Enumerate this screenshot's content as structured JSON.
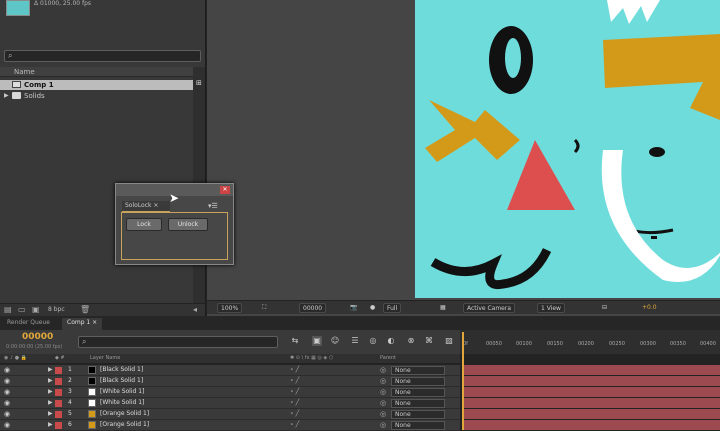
{
  "project": {
    "thumb_info": "Δ 01000, 25.00 fps",
    "search_placeholder": "",
    "column_name": "Name",
    "items": [
      {
        "label": "Comp 1"
      },
      {
        "label": "Solids"
      }
    ],
    "bpc": "8 bpc"
  },
  "viewer": {
    "zoom": "100%",
    "timecode": "00000",
    "resolution": "Full",
    "camera": "Active Camera",
    "view": "1 View",
    "exposure": "+0.0"
  },
  "solo_panel": {
    "tab_label": "SoloLock",
    "lock_label": "Lock",
    "unlock_label": "Unlock"
  },
  "tabs": {
    "render_queue": "Render Queue",
    "comp": "Comp 1"
  },
  "timeline": {
    "timecode": "00000",
    "timecode_sub": "0:00:00:00 (25.00 fps)",
    "col_layer_name": "Layer Name",
    "col_parent": "Parent",
    "ruler_ticks": [
      "0f",
      "00050",
      "00100",
      "00150",
      "00200",
      "00250",
      "00300",
      "00350",
      "00400"
    ],
    "layers": [
      {
        "num": "1",
        "name": "[Black Solid 1]",
        "parent": "None",
        "swatch": "#000000",
        "label_color": "#c84a4a"
      },
      {
        "num": "2",
        "name": "[Black Solid 1]",
        "parent": "None",
        "swatch": "#000000",
        "label_color": "#c84a4a"
      },
      {
        "num": "3",
        "name": "[White Solid 1]",
        "parent": "None",
        "swatch": "#ffffff",
        "label_color": "#c84a4a"
      },
      {
        "num": "4",
        "name": "[White Solid 1]",
        "parent": "None",
        "swatch": "#ffffff",
        "label_color": "#c84a4a"
      },
      {
        "num": "5",
        "name": "[Orange Solid 1]",
        "parent": "None",
        "swatch": "#d39a1a",
        "label_color": "#c84a4a"
      },
      {
        "num": "6",
        "name": "[Orange Solid 1]",
        "parent": "None",
        "swatch": "#d39a1a",
        "label_color": "#c84a4a"
      }
    ]
  },
  "colors": {
    "accent": "#e2a73a",
    "canvas": "#6fdcdc",
    "layer_bar": "#9c4a4f"
  }
}
